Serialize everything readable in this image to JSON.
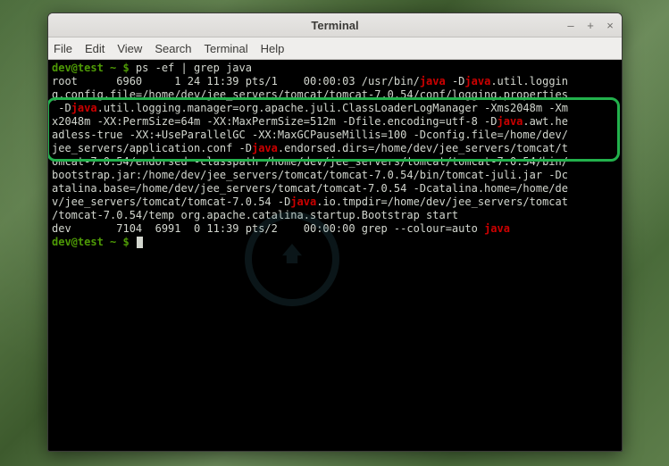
{
  "window": {
    "title": "Terminal",
    "controls": {
      "min": "–",
      "max": "+",
      "close": "×"
    }
  },
  "menubar": {
    "file": "File",
    "edit": "Edit",
    "view": "View",
    "search": "Search",
    "terminal": "Terminal",
    "help": "Help"
  },
  "prompt": {
    "userhost": "dev@test",
    "path": " ~ $ ",
    "command": "ps -ef | grep java"
  },
  "output": {
    "l1a": "root      6960     1 24 11:39 pts/1    00:00:03 /usr/bin/",
    "l1b": " -D",
    "l1c": ".util.loggin",
    "l2a": "g.config.file=/home/dev/jee_servers/tomcat/tomcat-7.0.54/conf/logging.properties",
    "l3a": " -D",
    "l3b": ".util.logging.manager=org.apache.juli.ClassLoaderLogManager -Xms2048m -Xm",
    "l4": "x2048m -XX:PermSize=64m -XX:MaxPermSize=512m -Dfile.encoding=utf-8 -D",
    "l4b": ".awt.he",
    "l5": "adless-true -XX:+UseParallelGC -XX:MaxGCPauseMillis=100 -Dconfig.file=/home/dev/",
    "l6a": "jee_servers/application.conf -D",
    "l6b": ".endorsed.dirs=/home/dev/jee_servers/tomcat/t",
    "l7": "omcat-7.0.54/endorsed -classpath /home/dev/jee_servers/tomcat/tomcat-7.0.54/bin/",
    "l8": "bootstrap.jar:/home/dev/jee_servers/tomcat/tomcat-7.0.54/bin/tomcat-juli.jar -Dc",
    "l9": "atalina.base=/home/dev/jee_servers/tomcat/tomcat-7.0.54 -Dcatalina.home=/home/de",
    "l10a": "v/jee_servers/tomcat/tomcat-7.0.54 -D",
    "l10b": ".io.tmpdir=/home/dev/jee_servers/tomcat",
    "l11": "/tomcat-7.0.54/temp org.apache.catalina.startup.Bootstrap start",
    "l12a": "dev       7104  6991  0 11:39 pts/2    00:00:00 grep --colour=auto ",
    "l12b": "java"
  },
  "prompt2": {
    "userhost": "dev@test",
    "path": " ~ $ "
  },
  "highlighted_java": "java"
}
